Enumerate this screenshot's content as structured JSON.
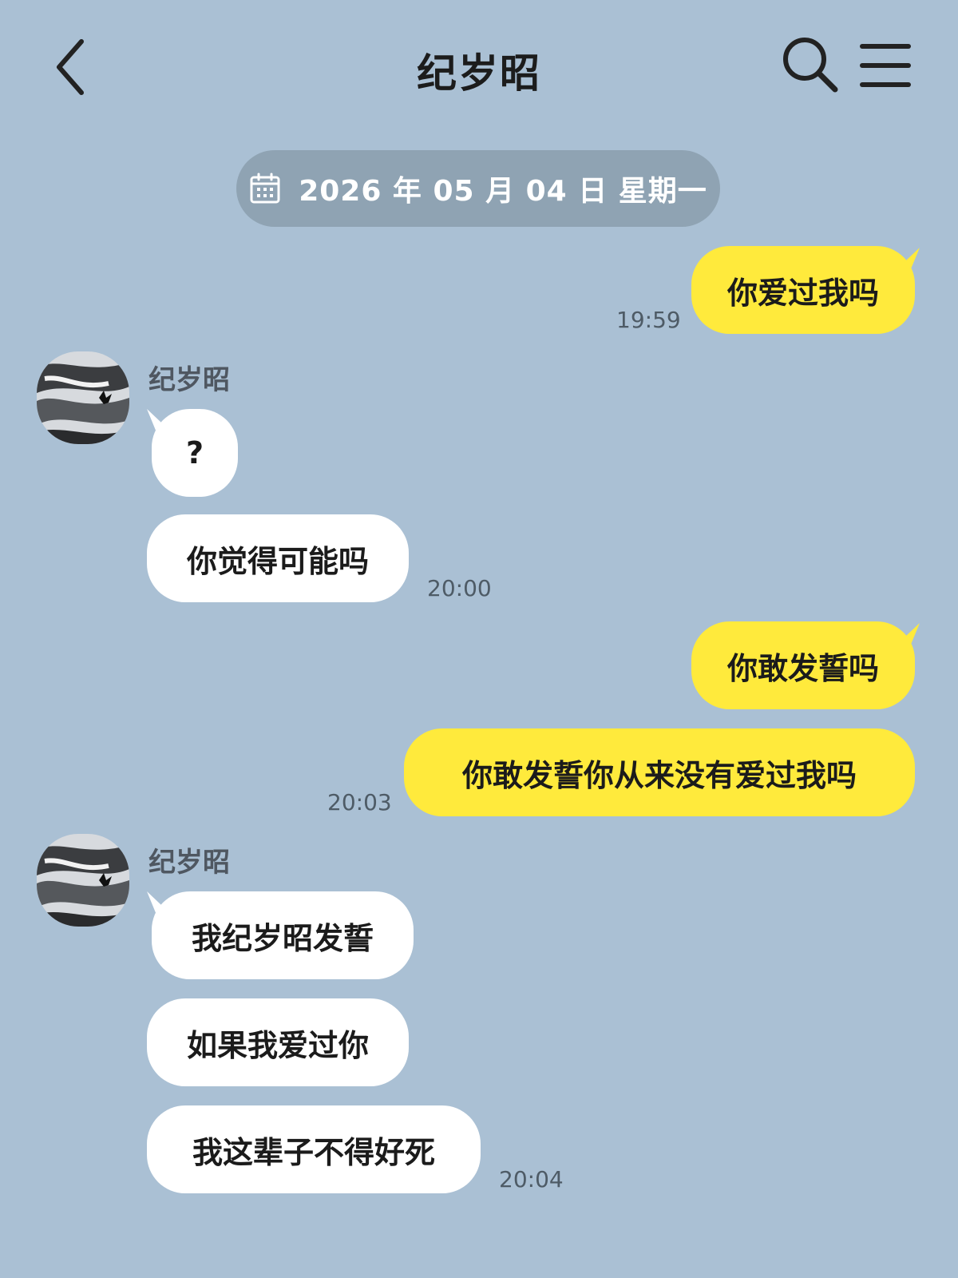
{
  "header": {
    "title": "纪岁昭",
    "back_icon": "chevron-left-icon",
    "search_icon": "search-icon",
    "menu_icon": "menu-icon"
  },
  "date_divider": {
    "icon": "calendar-icon",
    "text": "2026 年 05 月 04 日  星期一"
  },
  "colors": {
    "background": "#aac0d4",
    "outgoing_bubble": "#ffea3c",
    "incoming_bubble": "#ffffff",
    "date_pill": "#8fa3b3"
  },
  "messages": [
    {
      "direction": "out",
      "text": "你爱过我吗",
      "time": "19:59"
    },
    {
      "direction": "in",
      "sender": "纪岁昭",
      "text": "?"
    },
    {
      "direction": "in",
      "text": "你觉得可能吗",
      "time": "20:00"
    },
    {
      "direction": "out",
      "text": "你敢发誓吗"
    },
    {
      "direction": "out",
      "text": "你敢发誓你从来没有爱过我吗",
      "time": "20:03"
    },
    {
      "direction": "in",
      "sender": "纪岁昭",
      "text": "我纪岁昭发誓"
    },
    {
      "direction": "in",
      "text": "如果我爱过你"
    },
    {
      "direction": "in",
      "text": "我这辈子不得好死",
      "time": "20:04"
    }
  ]
}
